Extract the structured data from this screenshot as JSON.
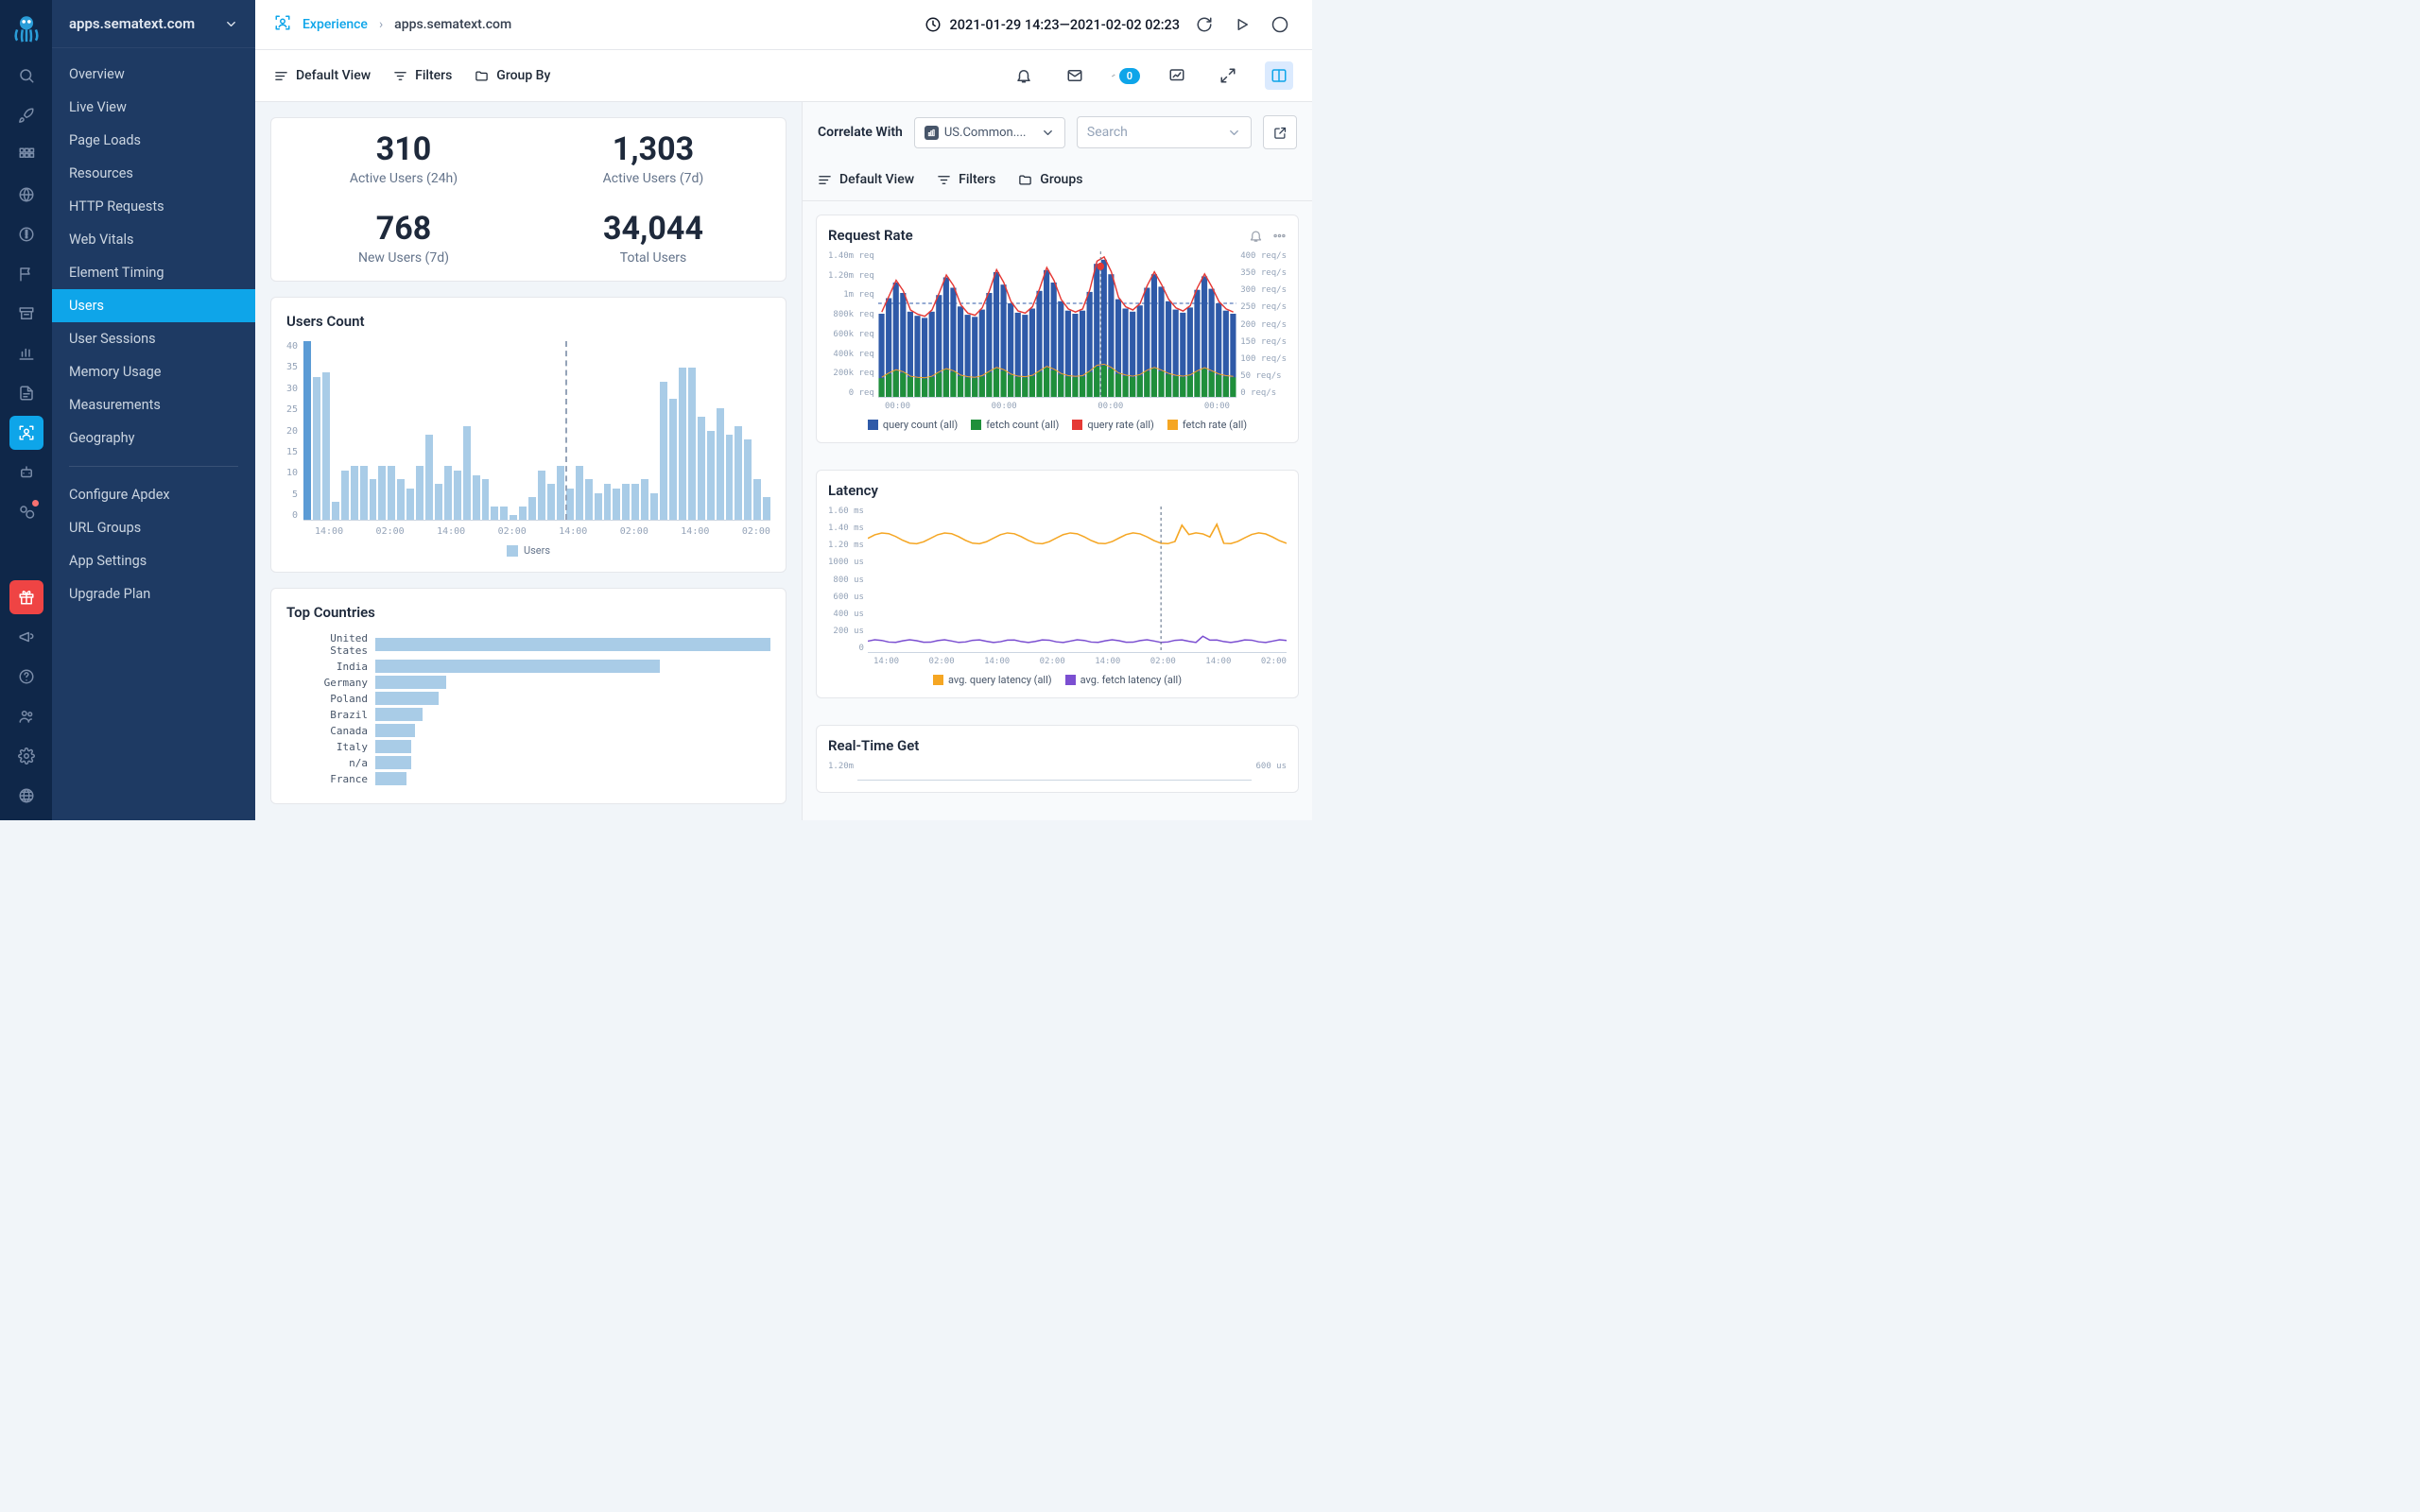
{
  "app_name": "apps.sematext.com",
  "breadcrumb": {
    "root": "Experience",
    "current": "apps.sematext.com"
  },
  "time_range": "2021-01-29 14:23—2021-02-02 02:23",
  "toolbar": {
    "default_view": "Default View",
    "filters": "Filters",
    "group_by": "Group By",
    "badge": "0"
  },
  "sidebar": {
    "items": [
      "Overview",
      "Live View",
      "Page Loads",
      "Resources",
      "HTTP Requests",
      "Web Vitals",
      "Element Timing",
      "Users",
      "User Sessions",
      "Memory Usage",
      "Measurements",
      "Geography"
    ],
    "items2": [
      "Configure Apdex",
      "URL Groups",
      "App Settings",
      "Upgrade Plan"
    ],
    "active": "Users"
  },
  "stats": {
    "active_24h": {
      "value": "310",
      "label": "Active Users (24h)"
    },
    "active_7d": {
      "value": "1,303",
      "label": "Active Users (7d)"
    },
    "new_7d": {
      "value": "768",
      "label": "New Users (7d)"
    },
    "total": {
      "value": "34,044",
      "label": "Total Users"
    }
  },
  "users_chart_title": "Users Count",
  "users_chart_legend": "Users",
  "top_countries_title": "Top Countries",
  "correlate": {
    "label": "Correlate With",
    "selected": "US.Common....",
    "search_placeholder": "Search",
    "default_view": "Default View",
    "filters": "Filters",
    "groups": "Groups"
  },
  "rp_cards": {
    "request_rate": "Request Rate",
    "latency": "Latency",
    "realtime": "Real-Time Get"
  },
  "chart_data": [
    {
      "type": "bar",
      "title": "Users Count",
      "ylabel": "Users",
      "ylim": [
        0,
        40
      ],
      "xticks": [
        "14:00",
        "02:00",
        "14:00",
        "02:00",
        "14:00",
        "02:00",
        "14:00",
        "02:00"
      ],
      "values": [
        40,
        32,
        33,
        4,
        11,
        12,
        12,
        9,
        12,
        12,
        9,
        7,
        12,
        19,
        8,
        12,
        11,
        21,
        10,
        9,
        3,
        3,
        1,
        3,
        5,
        11,
        8,
        12,
        7,
        12,
        9,
        6,
        8,
        7,
        8,
        8,
        9,
        6,
        31,
        27,
        34,
        34,
        23,
        20,
        25,
        19,
        21,
        18,
        9,
        5
      ]
    },
    {
      "type": "bar",
      "title": "Top Countries",
      "categories": [
        "United States",
        "India",
        "Germany",
        "Poland",
        "Brazil",
        "Canada",
        "Italy",
        "n/a",
        "France"
      ],
      "values": [
        100,
        72,
        18,
        16,
        12,
        10,
        9,
        9,
        8
      ]
    },
    {
      "type": "bar",
      "title": "Request Rate",
      "yleft_ticks": [
        "1.40m req",
        "1.20m req",
        "1m req",
        "800k req",
        "600k req",
        "400k req",
        "200k req",
        "0 req"
      ],
      "yright_ticks": [
        "400 req/s",
        "350 req/s",
        "300 req/s",
        "250 req/s",
        "200 req/s",
        "150 req/s",
        "100 req/s",
        "50 req/s",
        "0 req/s"
      ],
      "xticks": [
        "00:00",
        "00:00",
        "00:00",
        "00:00"
      ],
      "series": [
        {
          "name": "query count (all)",
          "color": "#2f5aa8"
        },
        {
          "name": "fetch count (all)",
          "color": "#1f8f3b"
        },
        {
          "name": "query rate (all)",
          "color": "#e53935"
        },
        {
          "name": "fetch rate (all)",
          "color": "#f5a623"
        }
      ],
      "query_counts": [
        800,
        950,
        1100,
        1000,
        820,
        780,
        760,
        820,
        980,
        1150,
        1050,
        870,
        790,
        770,
        840,
        1000,
        1200,
        1080,
        900,
        810,
        790,
        850,
        1020,
        1220,
        1100,
        920,
        830,
        800,
        830,
        1010,
        1280,
        1320,
        1180,
        940,
        850,
        820,
        880,
        1050,
        1180,
        1060,
        920,
        840,
        810,
        860,
        1030,
        1160,
        1040,
        900,
        830,
        800
      ],
      "fetch_counts": [
        180,
        220,
        250,
        230,
        190,
        180,
        175,
        190,
        230,
        260,
        240,
        200,
        185,
        180,
        195,
        235,
        270,
        250,
        210,
        190,
        185,
        198,
        240,
        280,
        255,
        215,
        195,
        188,
        195,
        238,
        290,
        300,
        270,
        220,
        200,
        190,
        205,
        245,
        270,
        245,
        215,
        198,
        190,
        202,
        240,
        268,
        240,
        210,
        195,
        188
      ]
    },
    {
      "type": "line",
      "title": "Latency",
      "yleft_ticks": [
        "1.60 ms",
        "1.40 ms",
        "1.20 ms",
        "1000 us",
        "800 us",
        "600 us",
        "400 us",
        "200 us",
        "0"
      ],
      "xticks": [
        "14:00",
        "02:00",
        "14:00",
        "02:00",
        "14:00",
        "02:00",
        "14:00",
        "02:00"
      ],
      "series": [
        {
          "name": "avg. query latency (all)",
          "color": "#f5a623"
        },
        {
          "name": "avg. fetch latency (all)",
          "color": "#7b4fd1"
        }
      ]
    },
    {
      "type": "line",
      "title": "Real-Time Get",
      "yleft_ticks": [
        "1.20m"
      ],
      "yright_ticks": [
        "600 us"
      ]
    }
  ]
}
